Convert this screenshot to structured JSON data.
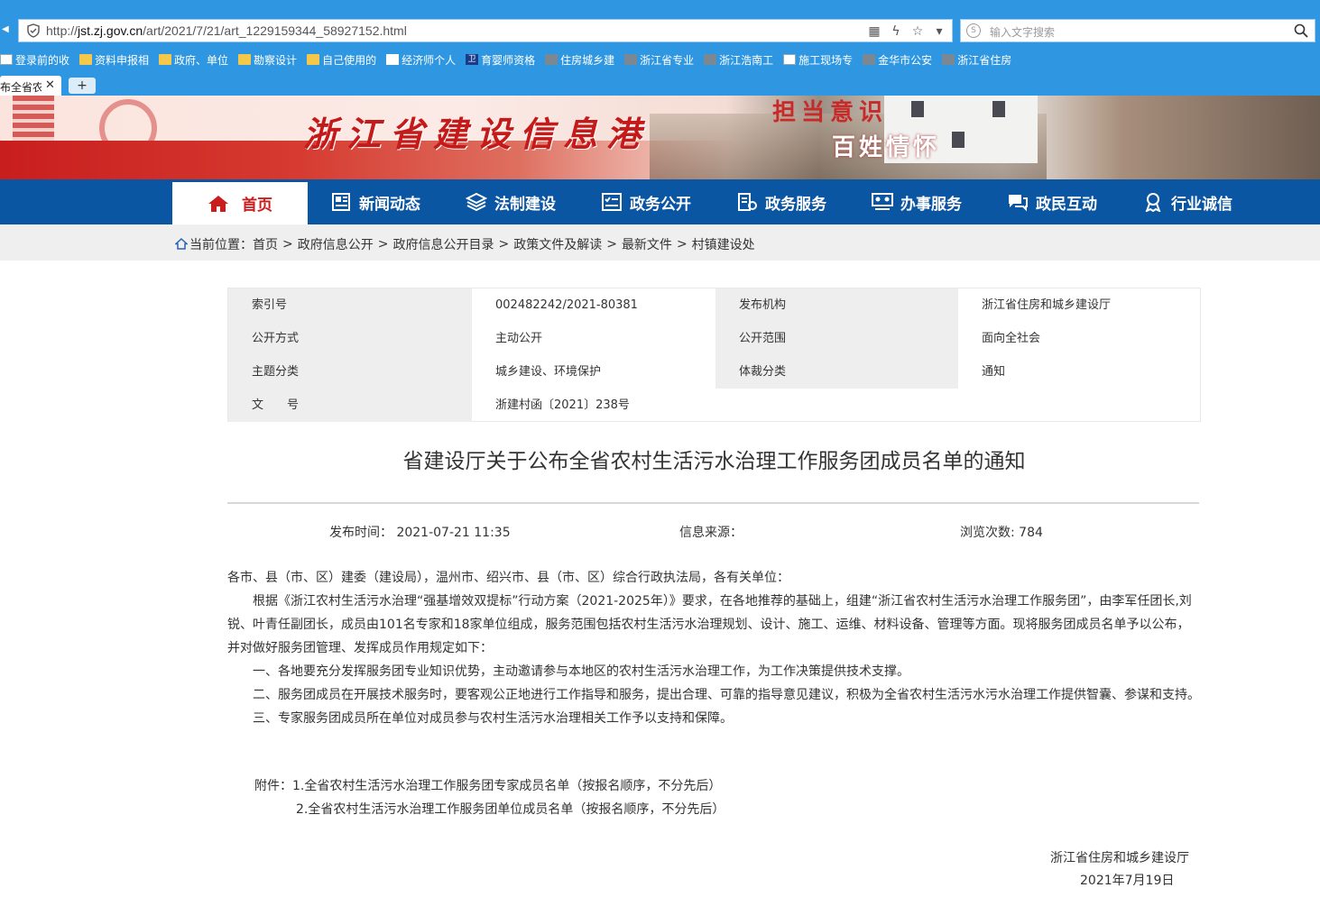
{
  "browser": {
    "url_prefix": "http://",
    "url_host": "jst.zj.gov.cn",
    "url_path": "/art/2021/7/21/art_1229159344_58927152.html",
    "search_placeholder": "输入文字搜索",
    "bookmarks": [
      {
        "label": "登录前的收",
        "icon": "page-icon"
      },
      {
        "label": "资料申报相",
        "icon": "folder-icon"
      },
      {
        "label": "政府、单位",
        "icon": "folder-icon"
      },
      {
        "label": "勘察设计",
        "icon": "folder-icon"
      },
      {
        "label": "自己使用的",
        "icon": "folder-icon"
      },
      {
        "label": "经济师个人",
        "icon": "site-icon"
      },
      {
        "label": "育婴师资格",
        "icon": "site-icon"
      },
      {
        "label": "住房城乡建",
        "icon": "site-icon"
      },
      {
        "label": "浙江省专业",
        "icon": "site-icon"
      },
      {
        "label": "浙江浩南工",
        "icon": "site-icon"
      },
      {
        "label": "施工现场专",
        "icon": "page-icon"
      },
      {
        "label": "金华市公安",
        "icon": "site-icon"
      },
      {
        "label": "浙江省住房",
        "icon": "site-icon"
      }
    ],
    "tab_label": "布全省农",
    "new_tab_label": "+",
    "tab_close": "✕"
  },
  "banner": {
    "title": "浙江省建设信息港",
    "slogan_top": "担当意识",
    "slogan_bottom": "百姓情怀"
  },
  "nav": {
    "items": [
      {
        "label": "首页",
        "icon": "home-icon",
        "active": true
      },
      {
        "label": "新闻动态",
        "icon": "news-icon"
      },
      {
        "label": "法制建设",
        "icon": "layers-icon"
      },
      {
        "label": "政务公开",
        "icon": "checklist-icon"
      },
      {
        "label": "政务服务",
        "icon": "service-icon"
      },
      {
        "label": "办事服务",
        "icon": "people-icon"
      },
      {
        "label": "政民互动",
        "icon": "chat-icon"
      },
      {
        "label": "行业诚信",
        "icon": "award-icon"
      }
    ]
  },
  "breadcrumb": {
    "prefix": "当前位置：",
    "items": [
      "首页",
      "政府信息公开",
      "政府信息公开目录",
      "政策文件及解读",
      "最新文件",
      "村镇建设处"
    ],
    "separator": ">"
  },
  "meta": {
    "rows": [
      {
        "k1": "索引号",
        "v1": "002482242/2021-80381",
        "k2": "发布机构",
        "v2": "浙江省住房和城乡建设厅"
      },
      {
        "k1": "公开方式",
        "v1": "主动公开",
        "k2": "公开范围",
        "v2": "面向全社会"
      },
      {
        "k1": "主题分类",
        "v1": "城乡建设、环境保护",
        "k2": "体裁分类",
        "v2": "通知"
      },
      {
        "k1": "文　　号",
        "v1": "浙建村函〔2021〕238号"
      }
    ]
  },
  "article": {
    "title": "省建设厅关于公布全省农村生活污水治理工作服务团成员名单的通知",
    "publish_label": "发布时间：",
    "publish_time": "2021-07-21 11:35",
    "source_label": "信息来源：",
    "views_label": "浏览次数:",
    "views": "784",
    "salutation": "各市、县（市、区）建委（建设局），温州市、绍兴市、县（市、区）综合行政执法局，各有关单位：",
    "intro": "根据《浙江农村生活污水治理“强基增效双提标”行动方案（2021-2025年）》要求，在各地推荐的基础上，组建“浙江省农村生活污水治理工作服务团”，由李军任团长,刘锐、叶青任副团长，成员由101名专家和18家单位组成，服务范围包括农村生活污水治理规划、设计、施工、运维、材料设备、管理等方面。现将服务团成员名单予以公布，并对做好服务团管理、发挥成员作用规定如下：",
    "points": [
      "一、各地要充分发挥服务团专业知识优势，主动邀请参与本地区的农村生活污水治理工作，为工作决策提供技术支撑。",
      "二、服务团成员在开展技术服务时，要客观公正地进行工作指导和服务，提出合理、可靠的指导意见建议，积极为全省农村生活污水污水治理工作提供智囊、参谋和支持。",
      "三、专家服务团成员所在单位对成员参与农村生活污水治理相关工作予以支持和保障。"
    ],
    "attach_label": "附件：",
    "attachments": [
      "1.全省农村生活污水治理工作服务团专家成员名单（按报名顺序，不分先后）",
      "2.全省农村生活污水治理工作服务团单位成员名单（按报名顺序，不分先后）"
    ],
    "signature": "浙江省住房和城乡建设厅",
    "date": "2021年7月19日"
  }
}
